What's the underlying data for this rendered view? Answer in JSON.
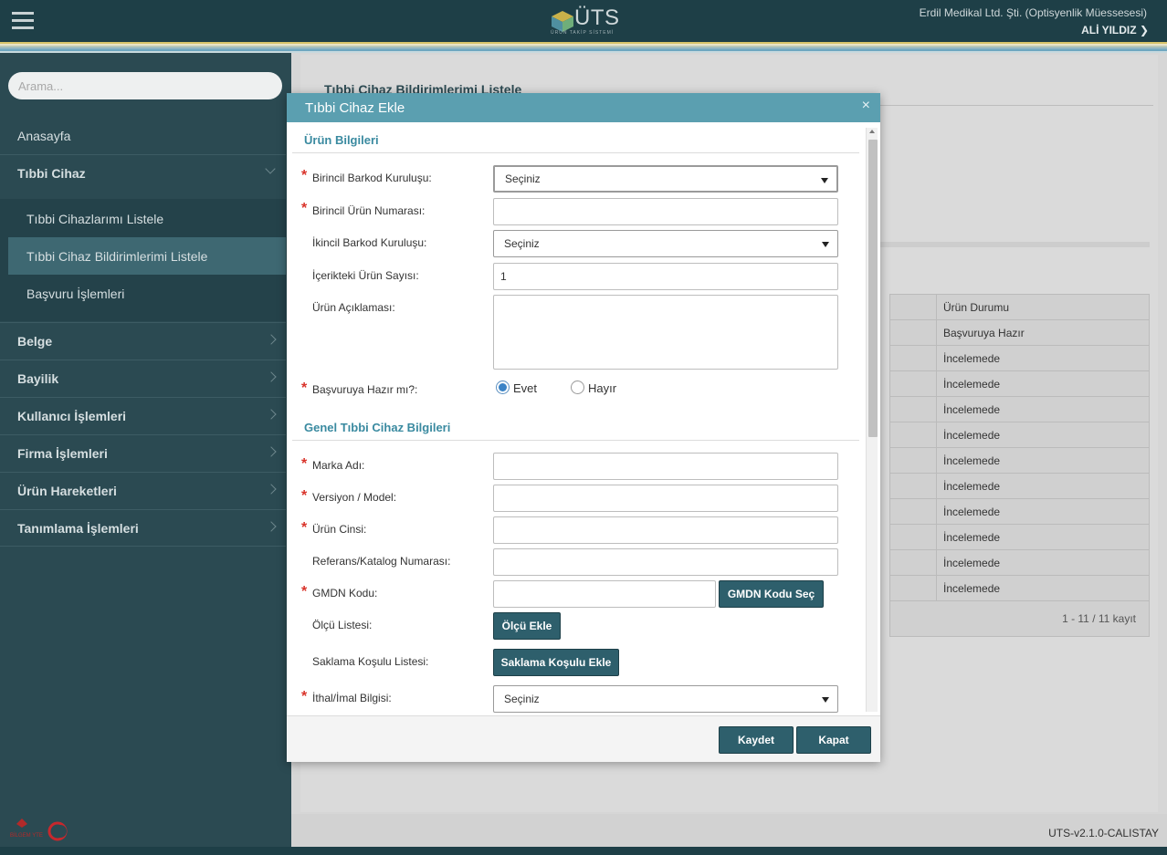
{
  "header": {
    "logo_text": "ÜTS",
    "logo_subtitle": "ÜRÜN TAKİP SİSTEMİ",
    "company": "Erdil Medikal Ltd. Şti. (Optisyenlik Müessesesi)",
    "user": "ALİ YILDIZ"
  },
  "sidebar": {
    "search_placeholder": "Arama...",
    "items": [
      {
        "label": "Anasayfa"
      },
      {
        "label": "Tıbbi Cihaz"
      },
      {
        "label": "Belge"
      },
      {
        "label": "Bayilik"
      },
      {
        "label": "Kullanıcı İşlemleri"
      },
      {
        "label": "Firma İşlemleri"
      },
      {
        "label": "Ürün Hareketleri"
      },
      {
        "label": "Tanımlama İşlemleri"
      }
    ],
    "subitems": [
      {
        "label": "Tıbbi Cihazlarımı Listele"
      },
      {
        "label": "Tıbbi Cihaz Bildirimlerimi Listele"
      },
      {
        "label": "Başvuru İşlemleri"
      }
    ],
    "footer_logo_text": "BİLGEM YTE"
  },
  "main": {
    "title": "Tıbbi Cihaz Bildirimlerimi Listele",
    "table": {
      "header": "Ürün Durumu",
      "rows": [
        "Başvuruya Hazır",
        "İncelemede",
        "İncelemede",
        "İncelemede",
        "İncelemede",
        "İncelemede",
        "İncelemede",
        "İncelemede",
        "İncelemede",
        "İncelemede",
        "İncelemede"
      ],
      "footer": "1 - 11 / 11 kayıt"
    }
  },
  "version": "UTS-v2.1.0-CALISTAY",
  "modal": {
    "title": "Tıbbi Cihaz Ekle",
    "close": "×",
    "section1": "Ürün Bilgileri",
    "section2": "Genel Tıbbi Cihaz Bilgileri",
    "fields": {
      "birincil_barkod_label": "Birincil Barkod Kuruluşu:",
      "birincil_barkod_value": "Seçiniz",
      "birincil_urun_label": "Birincil Ürün Numarası:",
      "birincil_urun_value": "",
      "ikincil_barkod_label": "İkincil Barkod Kuruluşu:",
      "ikincil_barkod_value": "Seçiniz",
      "icerik_sayi_label": "İçerikteki Ürün Sayısı:",
      "icerik_sayi_value": "1",
      "aciklama_label": "Ürün Açıklaması:",
      "aciklama_value": "",
      "basvuru_label": "Başvuruya Hazır mı?:",
      "radio_yes": "Evet",
      "radio_no": "Hayır",
      "marka_label": "Marka Adı:",
      "marka_value": "",
      "versiyon_label": "Versiyon / Model:",
      "versiyon_value": "",
      "cins_label": "Ürün Cinsi:",
      "cins_value": "",
      "referans_label": "Referans/Katalog Numarası:",
      "referans_value": "",
      "gmdn_label": "GMDN Kodu:",
      "gmdn_value": "",
      "gmdn_button": "GMDN Kodu Seç",
      "olcu_label": "Ölçü Listesi:",
      "olcu_button": "Ölçü Ekle",
      "saklama_label": "Saklama Koşulu Listesi:",
      "saklama_button": "Saklama Koşulu Ekle",
      "ithal_label": "İthal/İmal Bilgisi:",
      "ithal_value": "Seçiniz"
    },
    "buttons": {
      "save": "Kaydet",
      "close": "Kapat"
    },
    "required_mark": "*"
  },
  "icons": [
    "hamburger-menu-icon",
    "chevron-right-icon",
    "chevron-down-icon",
    "close-icon",
    "uts-logo-icon",
    "dropdown-arrow-icon"
  ],
  "colors": {
    "header_bg": "#1e3f47",
    "sidebar_bg": "#2b4a52",
    "modal_header": "#5b9fb0",
    "button": "#2e5f6c",
    "required": "#d9342b",
    "section_title": "#3a8aa0"
  }
}
